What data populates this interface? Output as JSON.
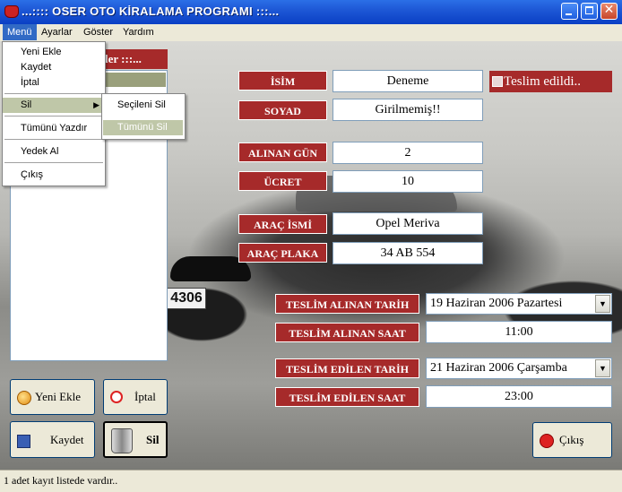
{
  "window": {
    "title": "...:::: OSER OTO KİRALAMA PROGRAMI :::...",
    "minimize_label": "_",
    "close_label": "✕"
  },
  "menubar": {
    "items": [
      {
        "label": "Menü",
        "active": true
      },
      {
        "label": "Ayarlar"
      },
      {
        "label": "Göster"
      },
      {
        "label": "Yardım"
      }
    ]
  },
  "menu_dropdown": {
    "items": [
      {
        "label": "Yeni Ekle"
      },
      {
        "label": "Kaydet"
      },
      {
        "label": "İptal"
      },
      {
        "label": "Sil",
        "has_submenu": true,
        "highlighted": true
      },
      {
        "label": "Tümünü Yazdır"
      },
      {
        "label": "Yedek Al"
      },
      {
        "label": "Çıkış"
      }
    ],
    "submenu_arrow": "▶"
  },
  "submenu": {
    "items": [
      {
        "label": "Seçileni Sil"
      },
      {
        "label": "Tümünü Sil",
        "highlighted": true
      }
    ]
  },
  "left_panel": {
    "header_visible_text": "ler :::..."
  },
  "buttons": {
    "yeni_ekle": "Yeni Ekle",
    "iptal": "İptal",
    "kaydet": "Kaydet",
    "sil": "Sil",
    "cikis": "Çıkış"
  },
  "form": {
    "isim_label": "İSİM",
    "isim_value": "Deneme",
    "soyad_label": "SOYAD",
    "soyad_value": "Girilmemiş!!",
    "alinan_gun_label": "ALINAN GÜN",
    "alinan_gun_value": "2",
    "ucret_label": "ÜCRET",
    "ucret_value": "10",
    "arac_ismi_label": "ARAÇ İSMİ",
    "arac_ismi_value": "Opel Meriva",
    "arac_plaka_label": "ARAÇ PLAKA",
    "arac_plaka_value": "34 AB 554",
    "teslim_edildi_label": "Teslim edildi..",
    "teslim_alinan_tarih_label": "TESLİM ALINAN TARİH",
    "teslim_alinan_tarih_value": "19  Haziran  2006  Pazartesi",
    "teslim_alinan_saat_label": "TESLİM ALINAN SAAT",
    "teslim_alinan_saat_value": "11:00",
    "teslim_edilen_tarih_label": "TESLİM EDİLEN TARİH",
    "teslim_edilen_tarih_value": "21  Haziran  2006 Çarşamba",
    "teslim_edilen_saat_label": "TESLİM EDİLEN SAAT",
    "teslim_edilen_saat_value": "23:00"
  },
  "background_plate_text": "4306",
  "statusbar": {
    "text": "1 adet kayıt listede vardır.."
  },
  "colors": {
    "label_red": "#a62a2a",
    "titlebar_blue": "#0a3fc4",
    "menu_highlight": "#bfc7a8"
  }
}
